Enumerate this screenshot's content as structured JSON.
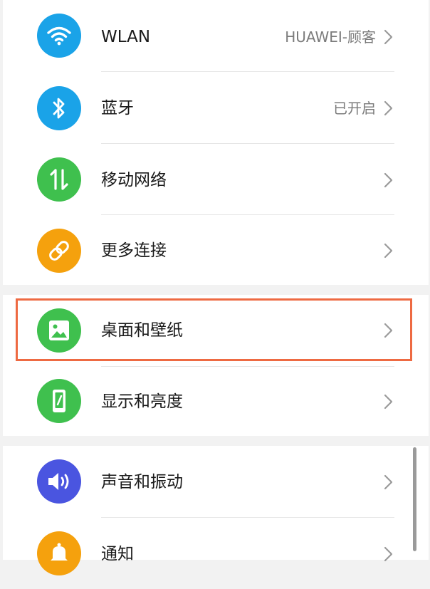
{
  "colors": {
    "wlan": "#1aa3e8",
    "bluetooth": "#1aa3e8",
    "mobile": "#3fc04e",
    "more": "#f5a10d",
    "wallpaper": "#3fc04e",
    "display": "#3fc04e",
    "sound": "#4a55e0",
    "notification": "#f5a10d",
    "highlight": "#ee6a42"
  },
  "settings": {
    "wlan": {
      "label": "WLAN",
      "value": "HUAWEI-顾客",
      "icon": "wifi-icon"
    },
    "bluetooth": {
      "label": "蓝牙",
      "value": "已开启",
      "icon": "bluetooth-icon"
    },
    "mobile_network": {
      "label": "移动网络",
      "icon": "mobile-data-icon"
    },
    "more_connections": {
      "label": "更多连接",
      "icon": "link-icon"
    },
    "wallpaper": {
      "label": "桌面和壁纸",
      "icon": "image-icon"
    },
    "display": {
      "label": "显示和亮度",
      "icon": "phone-brightness-icon"
    },
    "sound": {
      "label": "声音和振动",
      "icon": "speaker-icon"
    },
    "notification": {
      "label": "通知",
      "icon": "bell-icon"
    }
  }
}
